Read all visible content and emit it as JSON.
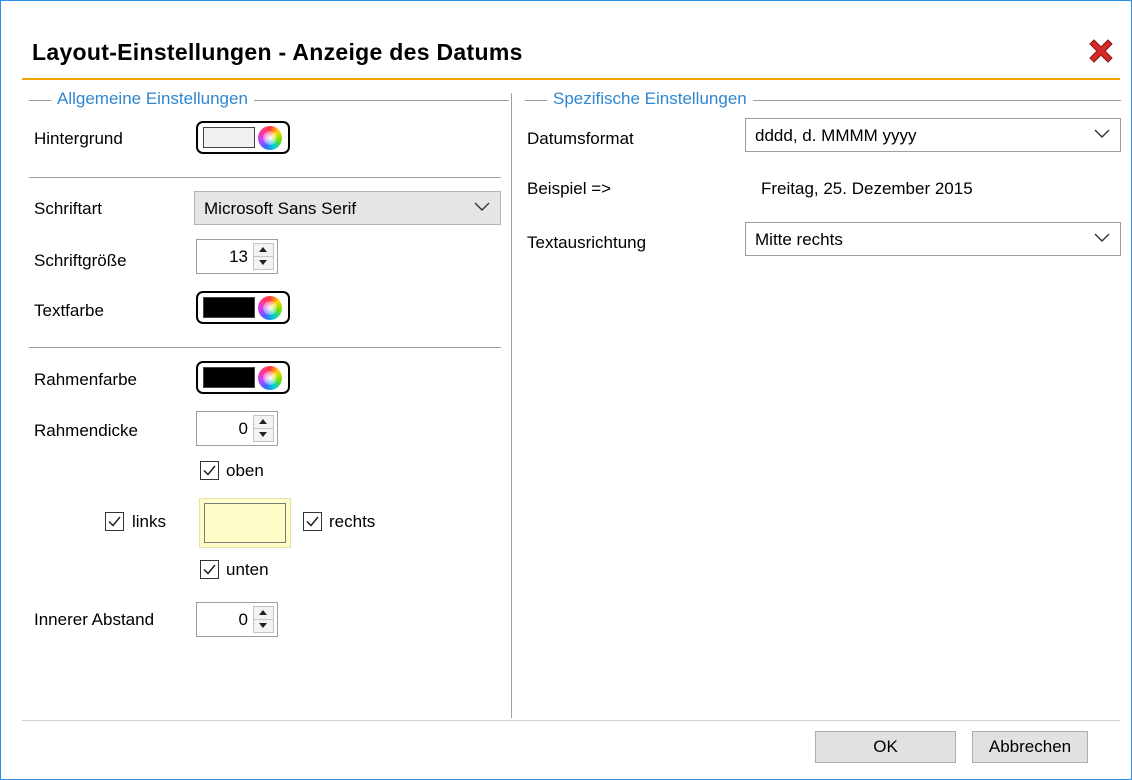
{
  "dialog": {
    "title": "Layout-Einstellungen - Anzeige des Datums"
  },
  "general": {
    "group_title": "Allgemeine Einstellungen",
    "background_label": "Hintergrund",
    "background_color": "#f0f0f0",
    "font_label": "Schriftart",
    "font_value": "Microsoft Sans Serif",
    "font_size_label": "Schriftgröße",
    "font_size_value": "13",
    "text_color_label": "Textfarbe",
    "text_color": "#000000",
    "border_color_label": "Rahmenfarbe",
    "border_color": "#000000",
    "border_width_label": "Rahmendicke",
    "border_width_value": "0",
    "sides": {
      "top_label": "oben",
      "top_checked": true,
      "left_label": "links",
      "left_checked": true,
      "right_label": "rechts",
      "right_checked": true,
      "bottom_label": "unten",
      "bottom_checked": true
    },
    "padding_label": "Innerer Abstand",
    "padding_value": "0"
  },
  "specific": {
    "group_title": "Spezifische Einstellungen",
    "date_format_label": "Datumsformat",
    "date_format_value": "dddd, d. MMMM yyyy",
    "example_label": "Beispiel =>",
    "example_value": "Freitag, 25. Dezember 2015",
    "alignment_label": "Textausrichtung",
    "alignment_value": "Mitte rechts"
  },
  "footer": {
    "ok_label": "OK",
    "cancel_label": "Abbrechen"
  },
  "colors": {
    "accent": "#f2a400",
    "group_title": "#2f86d0",
    "window_border": "#2b8fe6",
    "close": "#d62b2b"
  }
}
